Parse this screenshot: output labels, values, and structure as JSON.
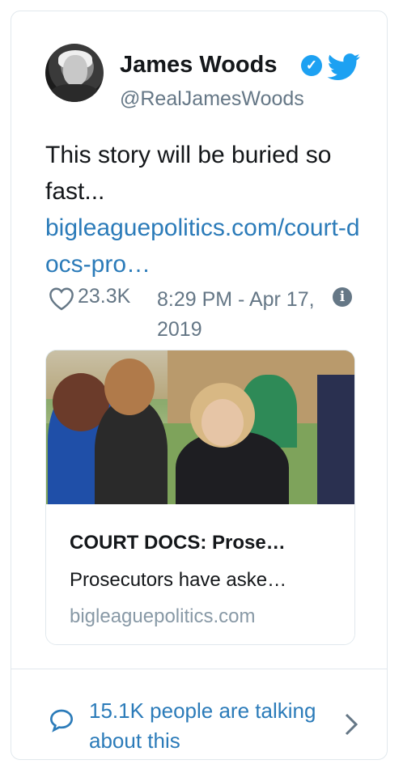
{
  "author": {
    "name": "James Woods",
    "handle": "@RealJamesWoods"
  },
  "tweet": {
    "text": "This story will be buried so fast...",
    "link": "bigleaguepolitics.com/court-docs-pro…",
    "likes": "23.3K",
    "timestamp": "8:29 PM - Apr 17, 2019"
  },
  "link_card": {
    "title": "COURT DOCS: Prose…",
    "description": "Prosecutors have aske…",
    "domain": "bigleaguepolitics.com"
  },
  "footer": {
    "talking": "15.1K people are talking about this"
  },
  "colors": {
    "link": "#2b7bb9",
    "muted": "#657786",
    "twitter_blue": "#1da1f2",
    "border": "#e1e8ed"
  },
  "icons": [
    "verified-badge-icon",
    "twitter-bird-icon",
    "heart-icon",
    "info-icon",
    "speech-bubble-icon",
    "chevron-right-icon"
  ]
}
